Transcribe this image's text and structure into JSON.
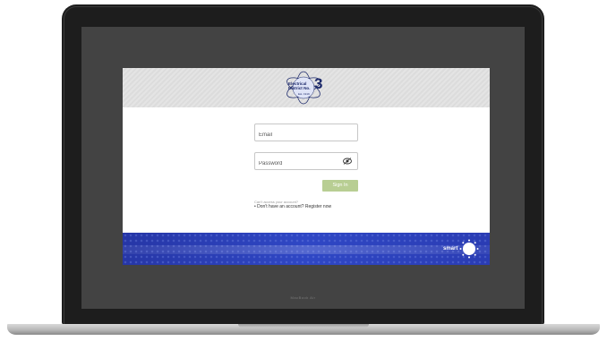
{
  "header": {
    "logo_line1": "Electrical",
    "logo_line2": "District No.",
    "logo_number": "3",
    "logo_sub": "Est. 1919"
  },
  "login": {
    "email_placeholder": "Email",
    "password_placeholder": "Password",
    "signin_label": "Sign In",
    "cant_access_text": "Can't access your account?",
    "register_text": "Don't have an account? Register now"
  },
  "footer": {
    "brand_text": "smart"
  },
  "bezel": {
    "caption": "MacBook Air"
  },
  "colors": {
    "signin_button": "#b8ce93",
    "footer_blue": "#2f47c5",
    "logo_navy": "#1d2a6b"
  },
  "icons": {
    "password_toggle": "eye-icon"
  }
}
